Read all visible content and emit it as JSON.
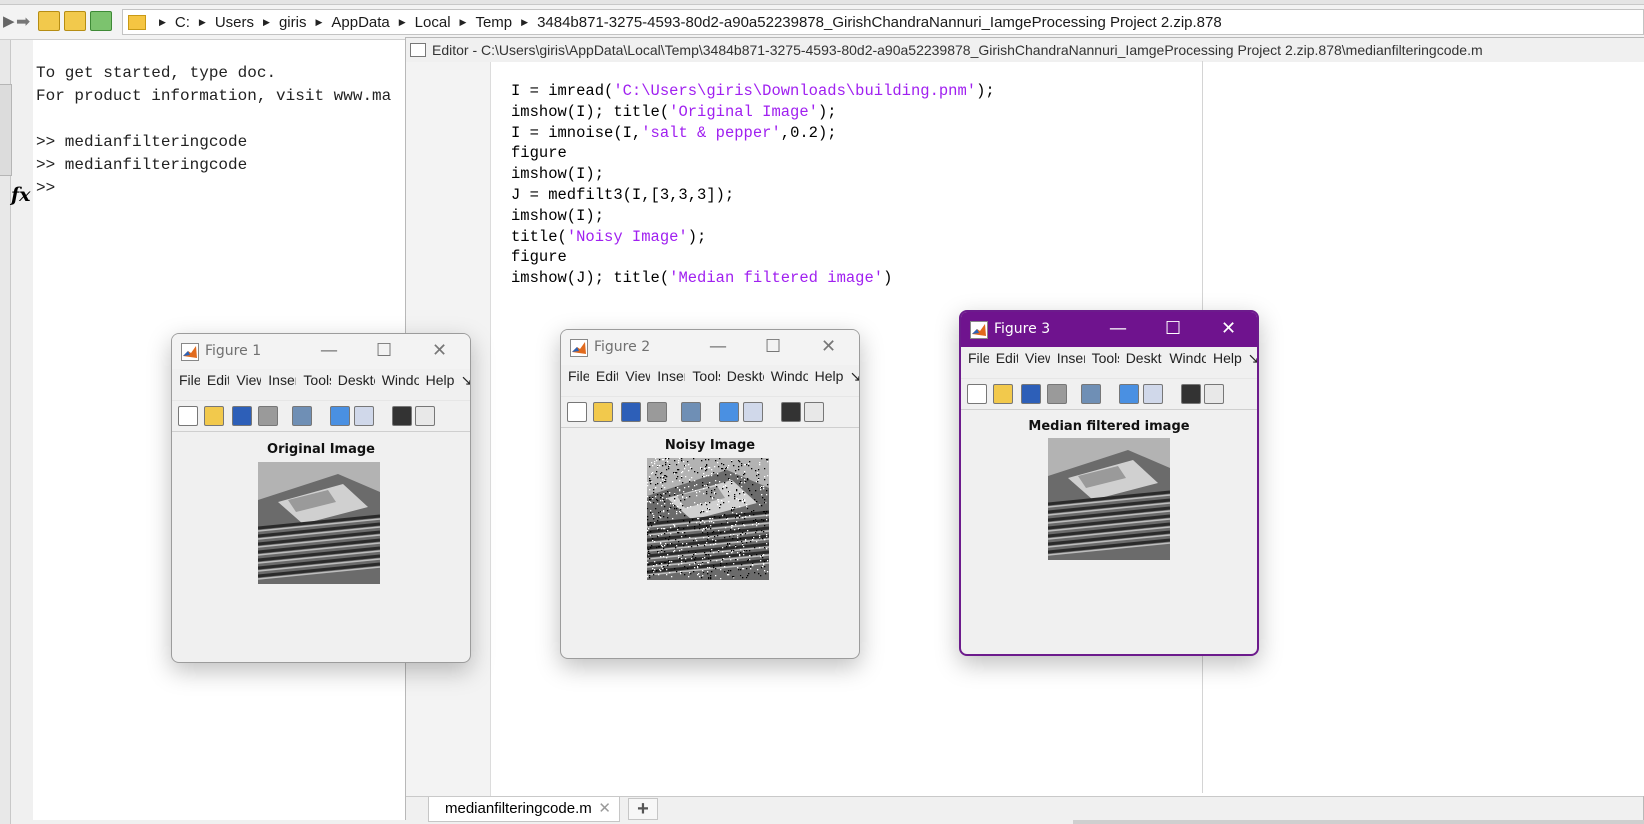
{
  "address_bar": {
    "path": [
      "C:",
      "Users",
      "giris",
      "AppData",
      "Local",
      "Temp",
      "3484b871-3275-4593-80d2-a90a52239878_GirishChandraNannuri_IamgeProcessing Project 2.zip.878"
    ]
  },
  "command_window": {
    "lines": [
      "To get started, type doc.",
      "For product information, visit www.ma",
      "",
      ">> medianfilteringcode",
      ">> medianfilteringcode",
      ">>"
    ]
  },
  "editor": {
    "title": "Editor - C:\\Users\\giris\\AppData\\Local\\Temp\\3484b871-3275-4593-80d2-a90a52239878_GirishChandraNannuri_IamgeProcessing Project 2.zip.878\\medianfilteringcode.m",
    "code": [
      [
        {
          "t": "I = imread("
        },
        {
          "t": "'C:\\Users\\giris\\Downloads\\building.pnm'",
          "s": true
        },
        {
          "t": ");"
        }
      ],
      [
        {
          "t": "imshow(I); title("
        },
        {
          "t": "'Original Image'",
          "s": true
        },
        {
          "t": ");"
        }
      ],
      [
        {
          "t": "I = imnoise(I,"
        },
        {
          "t": "'salt & pepper'",
          "s": true
        },
        {
          "t": ",0.2);"
        }
      ],
      [
        {
          "t": "figure"
        }
      ],
      [
        {
          "t": "imshow(I);"
        }
      ],
      [
        {
          "t": "J = medfilt3(I,[3,3,3]);"
        }
      ],
      [
        {
          "t": "imshow(I);"
        }
      ],
      [
        {
          "t": "title("
        },
        {
          "t": "'Noisy Image'",
          "s": true
        },
        {
          "t": ");"
        }
      ],
      [
        {
          "t": "figure"
        }
      ],
      [
        {
          "t": "imshow(J); title("
        },
        {
          "t": "'Median filtered image'",
          "s": true
        },
        {
          "t": ")"
        }
      ]
    ],
    "tab_label": "medianfilteringcode.m",
    "tab_close": "✕",
    "add_tab": "+"
  },
  "figures": [
    {
      "title": "Figure 1",
      "axes_title": "Original Image",
      "active": false
    },
    {
      "title": "Figure 2",
      "axes_title": "Noisy Image",
      "active": false
    },
    {
      "title": "Figure 3",
      "axes_title": "Median filtered image",
      "active": true
    }
  ],
  "figure_menu": [
    "File",
    "Edit",
    "View",
    "Insert",
    "Tools",
    "Desktop",
    "Window",
    "Help"
  ],
  "figure_menu_more": "↘",
  "window_controls": {
    "minimize": "—",
    "maximize": "☐",
    "close": "✕"
  }
}
